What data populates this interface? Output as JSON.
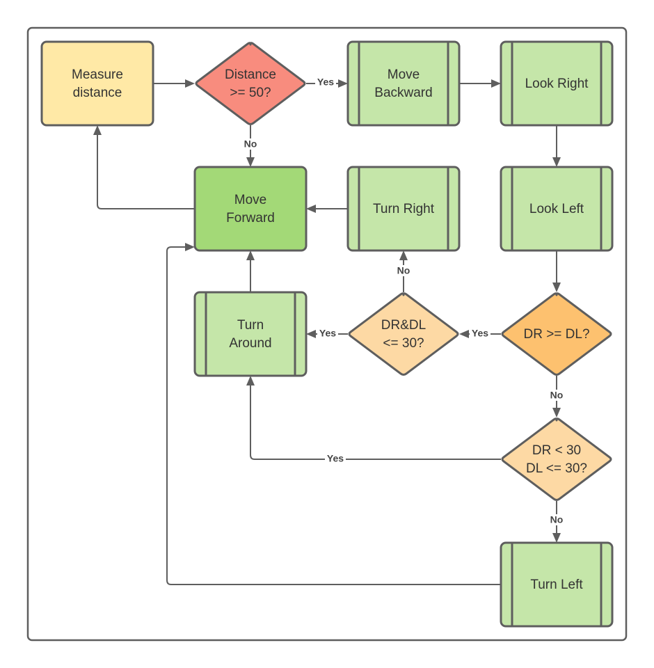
{
  "diagram": {
    "colors": {
      "yellow": "#FFE9A6",
      "red": "#F88C7E",
      "light_green": "#C5E6A9",
      "green": "#A3D977",
      "light_orange": "#FDD9A4",
      "orange": "#FDC16F",
      "stroke": "#5E5E5E"
    },
    "nodes": {
      "measure": {
        "lines": [
          "Measure",
          "distance"
        ],
        "shape": "process",
        "color": "yellow"
      },
      "dist_check": {
        "lines": [
          "Distance",
          ">= 50?"
        ],
        "shape": "decision",
        "color": "red"
      },
      "move_backward": {
        "lines": [
          "Move",
          "Backward"
        ],
        "shape": "subprocess",
        "color": "light_green"
      },
      "look_right": {
        "lines": [
          "Look Right"
        ],
        "shape": "subprocess",
        "color": "light_green"
      },
      "move_forward": {
        "lines": [
          "Move",
          "Forward"
        ],
        "shape": "process",
        "color": "green"
      },
      "turn_right": {
        "lines": [
          "Turn Right"
        ],
        "shape": "subprocess",
        "color": "light_green"
      },
      "look_left": {
        "lines": [
          "Look Left"
        ],
        "shape": "subprocess",
        "color": "light_green"
      },
      "turn_around": {
        "lines": [
          "Turn",
          "Around"
        ],
        "shape": "subprocess",
        "color": "light_green"
      },
      "both_close": {
        "lines": [
          "DR&DL",
          "<= 30?"
        ],
        "shape": "decision",
        "color": "light_orange"
      },
      "dr_ge_dl": {
        "lines": [
          "DR >= DL?"
        ],
        "shape": "decision",
        "color": "orange"
      },
      "dr_dl_small": {
        "lines": [
          "DR < 30",
          "DL <= 30?"
        ],
        "shape": "decision",
        "color": "light_orange"
      },
      "turn_left": {
        "lines": [
          "Turn Left"
        ],
        "shape": "subprocess",
        "color": "light_green"
      }
    },
    "edges": [
      {
        "from": "measure",
        "to": "dist_check",
        "label": ""
      },
      {
        "from": "dist_check",
        "to": "move_backward",
        "label": "Yes"
      },
      {
        "from": "dist_check",
        "to": "move_forward",
        "label": "No"
      },
      {
        "from": "move_backward",
        "to": "look_right",
        "label": ""
      },
      {
        "from": "look_right",
        "to": "look_left",
        "label": ""
      },
      {
        "from": "look_left",
        "to": "dr_ge_dl",
        "label": ""
      },
      {
        "from": "dr_ge_dl",
        "to": "both_close",
        "label": "Yes"
      },
      {
        "from": "dr_ge_dl",
        "to": "dr_dl_small",
        "label": "No"
      },
      {
        "from": "both_close",
        "to": "turn_around",
        "label": "Yes"
      },
      {
        "from": "both_close",
        "to": "turn_right",
        "label": "No"
      },
      {
        "from": "dr_dl_small",
        "to": "turn_around",
        "label": "Yes"
      },
      {
        "from": "dr_dl_small",
        "to": "turn_left",
        "label": "No"
      },
      {
        "from": "turn_right",
        "to": "move_forward",
        "label": ""
      },
      {
        "from": "turn_around",
        "to": "move_forward",
        "label": ""
      },
      {
        "from": "turn_left",
        "to": "move_forward",
        "label": ""
      },
      {
        "from": "move_forward",
        "to": "measure",
        "label": ""
      }
    ]
  }
}
